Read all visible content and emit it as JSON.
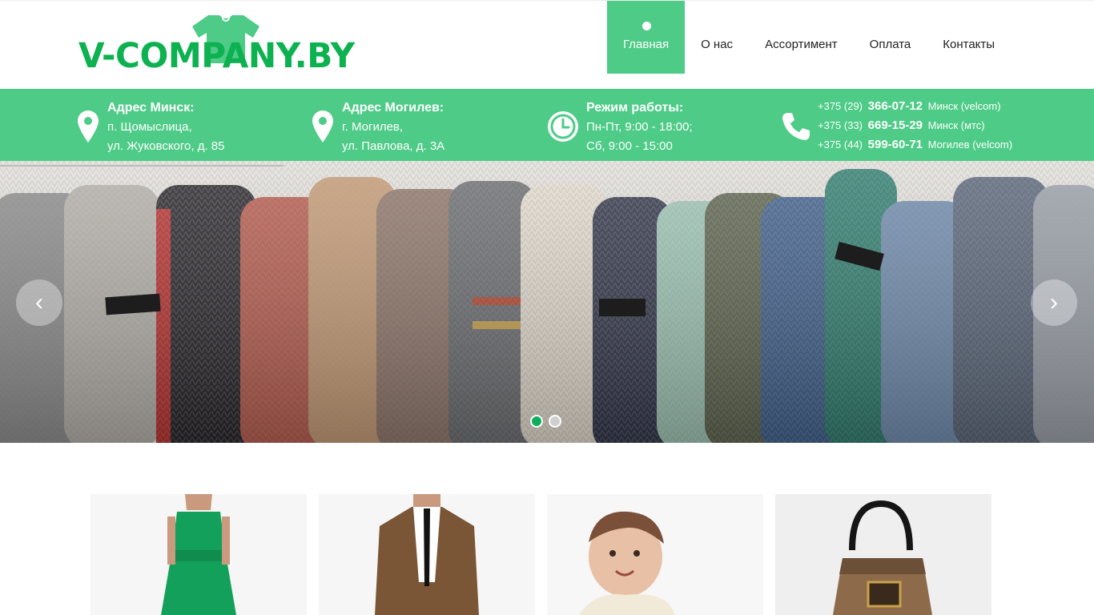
{
  "header": {
    "logo_text": "V-COMPANY.BY",
    "nav": [
      {
        "label": "Главная",
        "active": true
      },
      {
        "label": "О нас",
        "active": false
      },
      {
        "label": "Ассортимент",
        "active": false
      },
      {
        "label": "Оплата",
        "active": false
      },
      {
        "label": "Контакты",
        "active": false
      }
    ]
  },
  "info": {
    "minsk": {
      "title": "Адрес Минск:",
      "line1": "п. Щомыслица,",
      "line2": "ул. Жуковского, д. 85",
      "icon": "map-pin-icon"
    },
    "mogilev": {
      "title": "Адрес Могилев:",
      "line1": "г. Могилев,",
      "line2": "ул. Павлова, д. 3А",
      "icon": "map-pin-icon"
    },
    "hours": {
      "title": "Режим работы:",
      "line1": "Пн-Пт, 9:00 - 18:00;",
      "line2": "Сб, 9:00 - 15:00",
      "icon": "clock-icon"
    },
    "phones": [
      {
        "code": "+375 (29)",
        "number": "366-07-12",
        "note": "Минск (velcom)"
      },
      {
        "code": "+375 (33)",
        "number": "669-15-29",
        "note": "Минск (мтс)"
      },
      {
        "code": "+375 (44)",
        "number": "599-60-71",
        "note": "Могилев (velcom)"
      }
    ]
  },
  "slider": {
    "slide_count": 2,
    "active_slide": 1,
    "image": "knitted sweaters",
    "prev_icon": "chevron-left-icon",
    "next_icon": "chevron-right-icon"
  },
  "categories": [
    {
      "image": "woman in green dress"
    },
    {
      "image": "man in brown suit"
    },
    {
      "image": "smiling baby"
    },
    {
      "image": "leather handbag"
    }
  ],
  "colors": {
    "accent": "#4ecb87",
    "logo_green": "#0db150",
    "dot_active": "#0fae5e"
  }
}
